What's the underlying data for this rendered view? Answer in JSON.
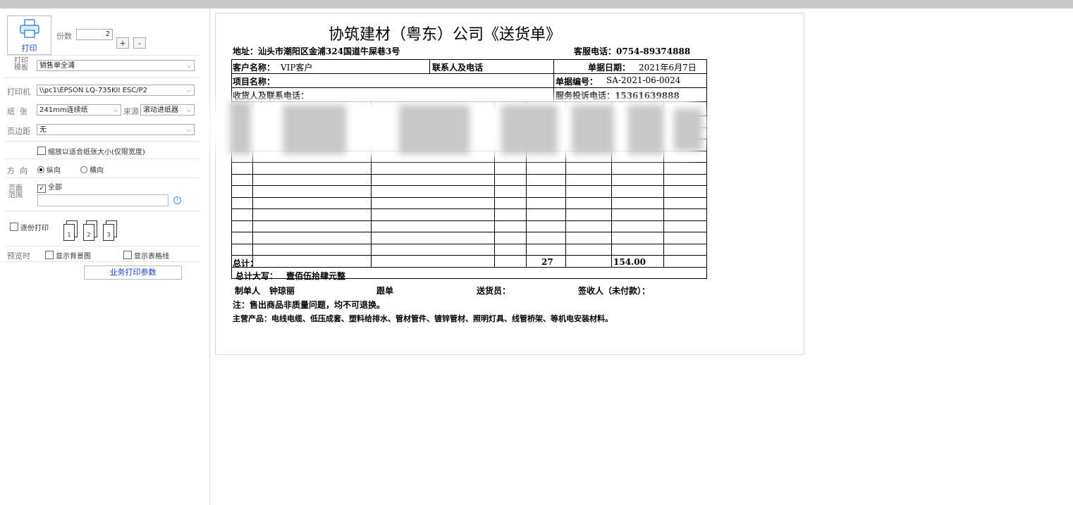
{
  "print": {
    "print_label": "打印",
    "copies_label": "份数",
    "copies_value": "2",
    "plus_label": "+",
    "minus_label": "-"
  },
  "settings": {
    "template_label": "打印\n模板",
    "template_value": "销售单全浦",
    "printer_label": "打印机",
    "printer_value": "\\\\pc1\\EPSON LQ-735KII ESC/P2",
    "paper_label": "纸  张",
    "paper_value": "241mm连续纸",
    "source_label": "来源",
    "source_value": "滚动进纸器",
    "margin_label": "页边距",
    "margin_value": "无",
    "scale_label": "缩放以适合纸张大小(仅限宽度)",
    "direction_label": "方  向",
    "portrait_label": "纵向",
    "landscape_label": "横向",
    "range_label": "页面\n范围",
    "all_label": "全部",
    "collate_label": "逐份打印",
    "preview_label": "预览时",
    "bg_label": "显示背景图",
    "grid_label": "显示表格线",
    "business_button": "业务打印参数"
  },
  "doc": {
    "title": "协筑建材（粤东）公司《送货单》",
    "address": "地址：汕头市潮阳区金浦324国道牛屎巷3号",
    "service_phone": "客服电话：0754-89374888",
    "customer_label": "客户名称：",
    "customer_value": "VIP客户",
    "contact_label": "联系人及电话",
    "date_label": "单据日期：",
    "date_value": "2021年6月7日",
    "project_label": "项目名称：",
    "number_label": "单据编号：",
    "number_value": "SA-2021-06-0024",
    "receiver_label": "收货人及联系电话：",
    "complaint_label": "服务投诉电话：15361639888",
    "total_label": "总计：",
    "total_qty": "27",
    "total_amount": "154.00",
    "uppercase_label": "总计大写：",
    "uppercase_value": "壹佰伍拾肆元整",
    "maker_label": "制单人",
    "maker_value": "钟琼丽",
    "follower_label": "跟单",
    "sender_label": "送货员：",
    "signer_label": "签收人（未付款）：",
    "note": "注：售出商品非质量问题，均不可退换。",
    "products": "主营产品：电线电缆、低压成套、塑料给排水、管材管件、镀锌管材、照明灯具、线管桥架、等机电安装材料。"
  },
  "colors": {
    "topbar": "#c8c8c8",
    "link_blue": "#1a3fd6"
  }
}
